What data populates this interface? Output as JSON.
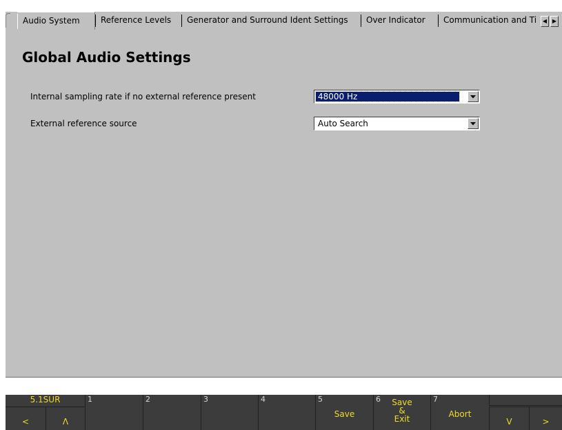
{
  "tabs": [
    {
      "label": "Audio System",
      "active": true
    },
    {
      "label": "Reference Levels",
      "active": false
    },
    {
      "label": "Generator and Surround Ident Settings",
      "active": false
    },
    {
      "label": "Over Indicator",
      "active": false
    },
    {
      "label": "Communication and Ti",
      "active": false
    }
  ],
  "tab_scroll": {
    "left_icon": "scroll-left-arrow",
    "right_icon": "scroll-right-arrow"
  },
  "page": {
    "title": "Global Audio Settings"
  },
  "settings": [
    {
      "label": "Internal sampling rate if no external reference present",
      "value": "48000 Hz",
      "focused": true
    },
    {
      "label": "External reference source",
      "value": "Auto Search",
      "focused": false
    }
  ],
  "softkeys": {
    "mode_label": "5.1SUR",
    "keys": [
      {
        "num": "1",
        "label": ""
      },
      {
        "num": "2",
        "label": ""
      },
      {
        "num": "3",
        "label": ""
      },
      {
        "num": "4",
        "label": ""
      },
      {
        "num": "5",
        "label": "Save"
      },
      {
        "num": "6",
        "label_lines": [
          "Save",
          "&",
          "Exit"
        ]
      },
      {
        "num": "7",
        "label": "Abort"
      }
    ],
    "nav": {
      "left": "<",
      "up": "Λ",
      "down": "V",
      "right": ">"
    }
  },
  "colors": {
    "panel": "#c0c0c0",
    "softkey_bg": "#3c3c3c",
    "softkey_text": "#f0dc28",
    "selection": "#0a1e6e"
  }
}
